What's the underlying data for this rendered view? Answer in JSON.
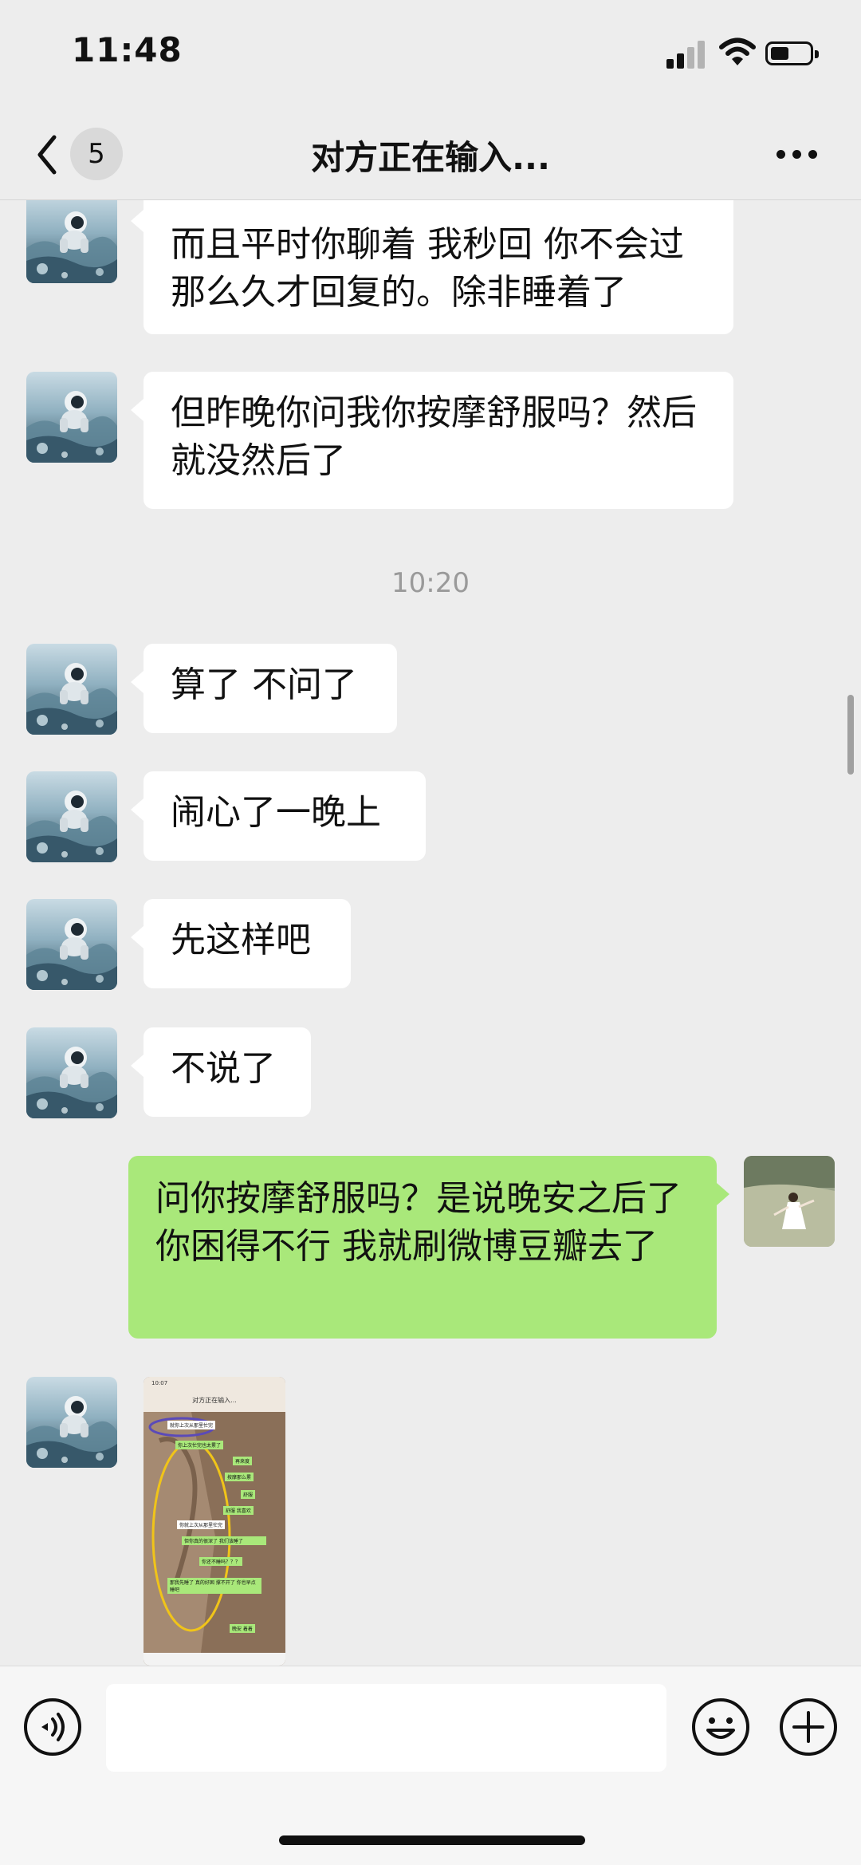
{
  "status_bar": {
    "time": "11:48"
  },
  "nav": {
    "unread_count": "5",
    "title": "对方正在输入..."
  },
  "messages": [
    {
      "text": "而且平时你聊着 我秒回 你不会过那么久才回复的。除非睡着了"
    },
    {
      "text": "但昨晚你问我你按摩舒服吗？然后就没然后了"
    },
    {
      "text": "算了 不问了"
    },
    {
      "text": "闹心了一晚上"
    },
    {
      "text": "先这样吧"
    },
    {
      "text": "不说了"
    },
    {
      "text": "问你按摩舒服吗？是说晚安之后了  你困得不行  我就刷微博豆瓣去了"
    }
  ],
  "timestamp": "10:20",
  "shared_screenshot": {
    "time": "10:07",
    "title": "对方正在输入...",
    "messages": [
      "就你上次从那里忙完",
      "你上次忙完也太累了",
      "再来度",
      "按摩那么累",
      "舒服",
      "舒服 我喜欢",
      "你就上次从那里忙完",
      "但你真的很深了 我们该睡了",
      "你还不睡吗？？？",
      "那我先睡了 真的好困 撑不开了 你也早点睡吧",
      "晚安 着着"
    ]
  },
  "input": {
    "placeholder": ""
  },
  "colors": {
    "background": "#ededed",
    "bubble_in": "#ffffff",
    "bubble_out": "#a9e87a",
    "timestamp": "#9a9a9a"
  },
  "icons": [
    "chevron-left-icon",
    "ellipsis-icon",
    "voice-icon",
    "emoji-icon",
    "plus-icon",
    "signal-icon",
    "wifi-icon",
    "battery-icon"
  ]
}
